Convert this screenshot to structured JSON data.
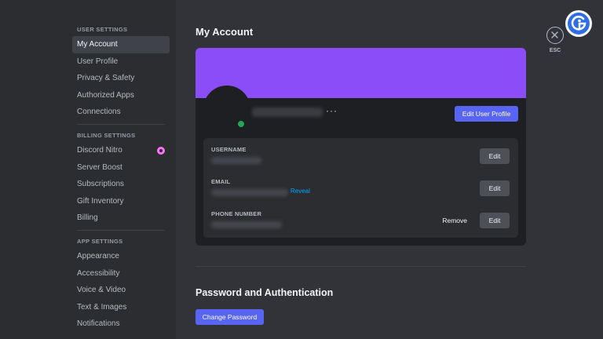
{
  "sidebar": {
    "sections": [
      {
        "header": "USER SETTINGS",
        "items": [
          "My Account",
          "User Profile",
          "Privacy & Safety",
          "Authorized Apps",
          "Connections"
        ]
      },
      {
        "header": "BILLING SETTINGS",
        "items": [
          "Discord Nitro",
          "Server Boost",
          "Subscriptions",
          "Gift Inventory",
          "Billing"
        ]
      },
      {
        "header": "APP SETTINGS",
        "items": [
          "Appearance",
          "Accessibility",
          "Voice & Video",
          "Text & Images",
          "Notifications"
        ]
      }
    ],
    "active_item": "My Account"
  },
  "main": {
    "title": "My Account",
    "profile_card": {
      "menu_dots": "···",
      "edit_profile_label": "Edit User Profile",
      "fields": [
        {
          "label": "USERNAME",
          "edit_label": "Edit"
        },
        {
          "label": "EMAIL",
          "reveal_label": "Reveal",
          "edit_label": "Edit"
        },
        {
          "label": "PHONE NUMBER",
          "remove_label": "Remove",
          "edit_label": "Edit"
        }
      ]
    },
    "password_section": {
      "title": "Password and Authentication",
      "change_password_label": "Change Password"
    }
  },
  "close": {
    "esc_label": "ESC"
  },
  "colors": {
    "accent": "#5865f2",
    "banner": "#8a4df7",
    "online": "#23a55a",
    "link": "#00a8fc"
  },
  "icons": {
    "close": "close-icon",
    "nitro": "nitro-icon",
    "logo": "logo-icon"
  }
}
